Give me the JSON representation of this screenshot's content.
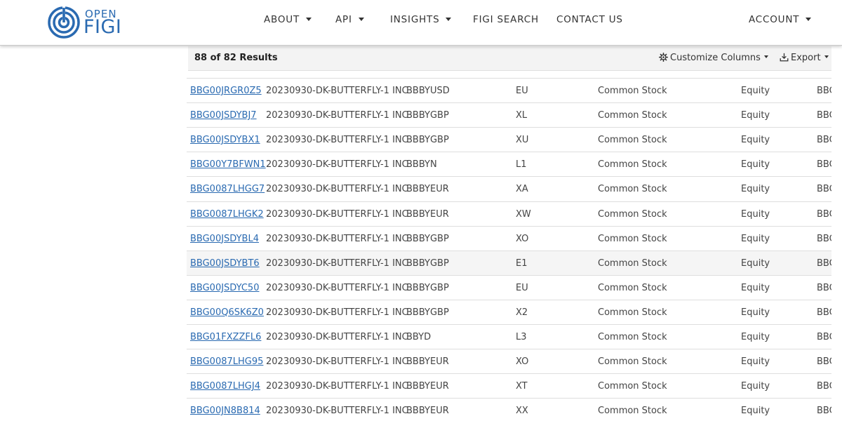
{
  "brand": {
    "logo_top": "OPEN",
    "logo_bottom": "FIGI",
    "color": "#2a6ab1"
  },
  "nav": {
    "items": [
      {
        "label": "ABOUT",
        "dropdown": true
      },
      {
        "label": "API",
        "dropdown": true
      },
      {
        "label": "INSIGHTS",
        "dropdown": true
      },
      {
        "label": "FIGI SEARCH",
        "dropdown": false
      },
      {
        "label": "CONTACT US",
        "dropdown": false
      },
      {
        "label": "ACCOUNT",
        "dropdown": true
      }
    ]
  },
  "results": {
    "count_label": "88 of 82 Results",
    "customize_label": "Customize Columns",
    "export_label": "Export",
    "customize_icon": "gear-icon",
    "export_icon": "download-icon"
  },
  "table": {
    "rows": [
      {
        "figi": "BBG00JRGR0Z5",
        "name": "20230930-DK-BUTTERFLY-1 INC",
        "ticker": "BBBYUSD",
        "exchange": "EU",
        "type": "Common Stock",
        "sector": "Equity",
        "extra": "BBG"
      },
      {
        "figi": "BBG00JSDYBJ7",
        "name": "20230930-DK-BUTTERFLY-1 INC",
        "ticker": "BBBYGBP",
        "exchange": "XL",
        "type": "Common Stock",
        "sector": "Equity",
        "extra": "BBG"
      },
      {
        "figi": "BBG00JSDYBX1",
        "name": "20230930-DK-BUTTERFLY-1 INC",
        "ticker": "BBBYGBP",
        "exchange": "XU",
        "type": "Common Stock",
        "sector": "Equity",
        "extra": "BBG"
      },
      {
        "figi": "BBG00Y7BFWN1",
        "name": "20230930-DK-BUTTERFLY-1 INC",
        "ticker": "BBBYN",
        "exchange": "L1",
        "type": "Common Stock",
        "sector": "Equity",
        "extra": "BBG"
      },
      {
        "figi": "BBG0087LHGG7",
        "name": "20230930-DK-BUTTERFLY-1 INC",
        "ticker": "BBBYEUR",
        "exchange": "XA",
        "type": "Common Stock",
        "sector": "Equity",
        "extra": "BBG"
      },
      {
        "figi": "BBG0087LHGK2",
        "name": "20230930-DK-BUTTERFLY-1 INC",
        "ticker": "BBBYEUR",
        "exchange": "XW",
        "type": "Common Stock",
        "sector": "Equity",
        "extra": "BBG"
      },
      {
        "figi": "BBG00JSDYBL4",
        "name": "20230930-DK-BUTTERFLY-1 INC",
        "ticker": "BBBYGBP",
        "exchange": "XO",
        "type": "Common Stock",
        "sector": "Equity",
        "extra": "BBG"
      },
      {
        "figi": "BBG00JSDYBT6",
        "name": "20230930-DK-BUTTERFLY-1 INC",
        "ticker": "BBBYGBP",
        "exchange": "E1",
        "type": "Common Stock",
        "sector": "Equity",
        "extra": "BBG"
      },
      {
        "figi": "BBG00JSDYC50",
        "name": "20230930-DK-BUTTERFLY-1 INC",
        "ticker": "BBBYGBP",
        "exchange": "EU",
        "type": "Common Stock",
        "sector": "Equity",
        "extra": "BBG"
      },
      {
        "figi": "BBG00Q6SK6Z0",
        "name": "20230930-DK-BUTTERFLY-1 INC",
        "ticker": "BBBYGBP",
        "exchange": "X2",
        "type": "Common Stock",
        "sector": "Equity",
        "extra": "BBG"
      },
      {
        "figi": "BBG01FXZZFL6",
        "name": "20230930-DK-BUTTERFLY-1 INC",
        "ticker": "BBYD",
        "exchange": "L3",
        "type": "Common Stock",
        "sector": "Equity",
        "extra": "BBG"
      },
      {
        "figi": "BBG0087LHG95",
        "name": "20230930-DK-BUTTERFLY-1 INC",
        "ticker": "BBBYEUR",
        "exchange": "XO",
        "type": "Common Stock",
        "sector": "Equity",
        "extra": "BBG"
      },
      {
        "figi": "BBG0087LHGJ4",
        "name": "20230930-DK-BUTTERFLY-1 INC",
        "ticker": "BBBYEUR",
        "exchange": "XT",
        "type": "Common Stock",
        "sector": "Equity",
        "extra": "BBG"
      },
      {
        "figi": "BBG00JN8B814",
        "name": "20230930-DK-BUTTERFLY-1 INC",
        "ticker": "BBBYEUR",
        "exchange": "XX",
        "type": "Common Stock",
        "sector": "Equity",
        "extra": "BBG"
      }
    ]
  }
}
